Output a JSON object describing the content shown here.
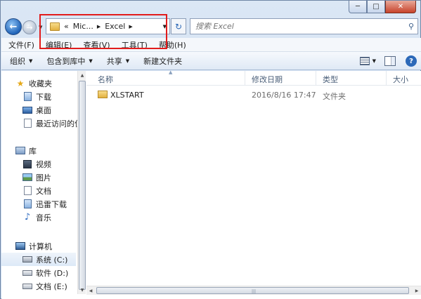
{
  "window": {
    "caption_buttons": [
      "minimize",
      "maximize",
      "close"
    ]
  },
  "nav": {
    "back_icon": "back-arrow-icon",
    "forward_icon": "forward-arrow-icon",
    "recent_icon": "chevron-down-icon"
  },
  "address": {
    "prefix": "«",
    "segments": [
      "Mic...",
      "Excel"
    ],
    "dropdown_icon": "chevron-down-icon"
  },
  "search": {
    "placeholder": "搜索 Excel",
    "icon": "magnifier-icon"
  },
  "menubar": {
    "items": [
      "文件(F)",
      "编辑(E)",
      "查看(V)",
      "工具(T)",
      "帮助(H)"
    ]
  },
  "toolbar": {
    "organize": "组织",
    "include_in_library": "包含到库中",
    "share": "共享",
    "new_folder": "新建文件夹"
  },
  "navpane": {
    "favorites": {
      "label": "收藏夹",
      "items": [
        "下载",
        "桌面",
        "最近访问的位"
      ]
    },
    "libraries": {
      "label": "库",
      "items": [
        "视频",
        "图片",
        "文档",
        "迅雷下载",
        "音乐"
      ]
    },
    "computer": {
      "label": "计算机",
      "items": [
        "系统 (C:)",
        "软件 (D:)",
        "文档 (E:)"
      ]
    }
  },
  "filelist": {
    "columns": [
      "名称",
      "修改日期",
      "类型",
      "大小"
    ],
    "rows": [
      {
        "name": "XLSTART",
        "date": "2016/8/16 17:47",
        "type": "文件夹",
        "size": ""
      }
    ]
  }
}
